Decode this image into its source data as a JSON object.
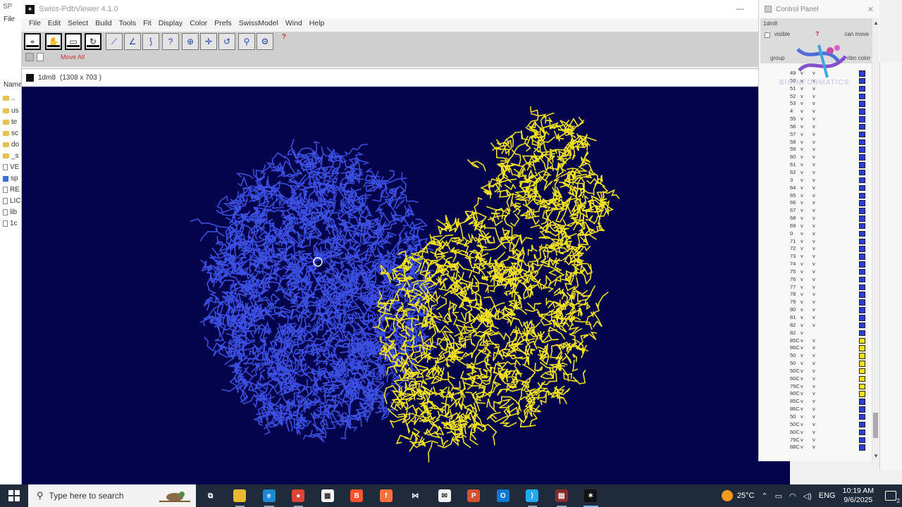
{
  "background_explorer": {
    "title": "SP",
    "file_menu": "File",
    "name_header": "Name",
    "rows": [
      {
        "icon": "folder",
        "label": ".."
      },
      {
        "icon": "folder",
        "label": "us"
      },
      {
        "icon": "folder",
        "label": "te"
      },
      {
        "icon": "folder",
        "label": "sc"
      },
      {
        "icon": "folder",
        "label": "do"
      },
      {
        "icon": "folder",
        "label": "_s"
      },
      {
        "icon": "file",
        "label": "VE"
      },
      {
        "icon": "selected",
        "label": "sp"
      },
      {
        "icon": "file",
        "label": "RE"
      },
      {
        "icon": "file",
        "label": "LIC"
      },
      {
        "icon": "file",
        "label": "lib"
      },
      {
        "icon": "file",
        "label": "1c"
      }
    ]
  },
  "app": {
    "title": "Swiss-PdbViewer 4.1.0",
    "menu": [
      "File",
      "Edit",
      "Select",
      "Build",
      "Tools",
      "Fit",
      "Display",
      "Color",
      "Prefs",
      "SwissModel",
      "Wind",
      "Help"
    ],
    "toolbar_help": "?",
    "move_all_label": "Move All",
    "tool_icons": [
      "select-tool-icon",
      "translate-tool-icon",
      "zoom-tool-icon",
      "rotate-tool-icon",
      "distance-tool-icon",
      "angle-tool-icon",
      "dihedral-tool-icon",
      "label-tool-icon",
      "center-tool-icon",
      "fit-tool-icon",
      "mutate-tool-icon",
      "torsion-tool-icon",
      "hbond-tool-icon"
    ],
    "tool_glyphs": [
      "⌖",
      "✋",
      "▭",
      "↻",
      "⟋",
      "∠",
      "⟆",
      "?",
      "⊕",
      "✛",
      "↺",
      "⚲",
      "⚙"
    ]
  },
  "viewer": {
    "title": "1dm8",
    "size_label": "(1308 x 703 )",
    "colors": {
      "background": "#04044d",
      "chain_a": "#3a4ee0",
      "chain_b": "#f0e020"
    }
  },
  "control_panel": {
    "title": "Control Panel",
    "protein_name": "1dm8",
    "visible_label": "visible",
    "help": "?",
    "can_move_label": "can move",
    "group_label": "group",
    "colors_label": "ribn color",
    "rows": [
      {
        "rn": "49",
        "v1": "v",
        "v2": "v",
        "color": "blue"
      },
      {
        "rn": "50",
        "v1": "v",
        "v2": "v",
        "color": "blue"
      },
      {
        "rn": "51",
        "v1": "v",
        "v2": "v",
        "color": "blue"
      },
      {
        "rn": "52",
        "v1": "v",
        "v2": "v",
        "color": "blue"
      },
      {
        "rn": "53",
        "v1": "v",
        "v2": "v",
        "color": "blue"
      },
      {
        "rn": "4",
        "v1": "v",
        "v2": "v",
        "color": "blue"
      },
      {
        "rn": "55",
        "v1": "v",
        "v2": "v",
        "color": "blue"
      },
      {
        "rn": "56",
        "v1": "v",
        "v2": "v",
        "color": "blue"
      },
      {
        "rn": "57",
        "v1": "v",
        "v2": "v",
        "color": "blue"
      },
      {
        "rn": "58",
        "v1": "v",
        "v2": "v",
        "color": "blue"
      },
      {
        "rn": "59",
        "v1": "v",
        "v2": "v",
        "color": "blue"
      },
      {
        "rn": "60",
        "v1": "v",
        "v2": "v",
        "color": "blue"
      },
      {
        "rn": "61",
        "v1": "v",
        "v2": "v",
        "color": "blue"
      },
      {
        "rn": "62",
        "v1": "v",
        "v2": "v",
        "color": "blue"
      },
      {
        "rn": "3",
        "v1": "v",
        "v2": "v",
        "color": "blue"
      },
      {
        "rn": "64",
        "v1": "v",
        "v2": "v",
        "color": "blue"
      },
      {
        "rn": "65",
        "v1": "v",
        "v2": "v",
        "color": "blue"
      },
      {
        "rn": "66",
        "v1": "v",
        "v2": "v",
        "color": "blue"
      },
      {
        "rn": "67",
        "v1": "v",
        "v2": "v",
        "color": "blue"
      },
      {
        "rn": "68",
        "v1": "v",
        "v2": "v",
        "color": "blue"
      },
      {
        "rn": "69",
        "v1": "v",
        "v2": "v",
        "color": "blue"
      },
      {
        "rn": "0",
        "v1": "v",
        "v2": "v",
        "color": "blue"
      },
      {
        "rn": "71",
        "v1": "v",
        "v2": "v",
        "color": "blue"
      },
      {
        "rn": "72",
        "v1": "v",
        "v2": "v",
        "color": "blue"
      },
      {
        "rn": "73",
        "v1": "v",
        "v2": "v",
        "color": "blue"
      },
      {
        "rn": "74",
        "v1": "v",
        "v2": "v",
        "color": "blue"
      },
      {
        "rn": "75",
        "v1": "v",
        "v2": "v",
        "color": "blue"
      },
      {
        "rn": "76",
        "v1": "v",
        "v2": "v",
        "color": "blue"
      },
      {
        "rn": "77",
        "v1": "v",
        "v2": "v",
        "color": "blue"
      },
      {
        "rn": "78",
        "v1": "v",
        "v2": "v",
        "color": "blue"
      },
      {
        "rn": "79",
        "v1": "v",
        "v2": "v",
        "color": "blue"
      },
      {
        "rn": "80",
        "v1": "v",
        "v2": "v",
        "color": "blue"
      },
      {
        "rn": "81",
        "v1": "v",
        "v2": "v",
        "color": "blue"
      },
      {
        "rn": "82",
        "v1": "v",
        "v2": "v",
        "color": "blue"
      },
      {
        "rn": "82",
        "v1": "v",
        "v2": "",
        "color": "blue"
      },
      {
        "rn": "85C",
        "v1": "v",
        "v2": "v",
        "color": "yellow"
      },
      {
        "rn": "86C",
        "v1": "v",
        "v2": "v",
        "color": "yellow"
      },
      {
        "rn": "50",
        "v1": "v",
        "v2": "v",
        "color": "yellow"
      },
      {
        "rn": "50",
        "v1": "v",
        "v2": "v",
        "color": "yellow"
      },
      {
        "rn": "50C",
        "v1": "v",
        "v2": "v",
        "color": "yellow"
      },
      {
        "rn": "60C",
        "v1": "v",
        "v2": "v",
        "color": "yellow"
      },
      {
        "rn": "79C",
        "v1": "v",
        "v2": "v",
        "color": "yellow"
      },
      {
        "rn": "80C",
        "v1": "v",
        "v2": "v",
        "color": "yellow"
      },
      {
        "rn": "85C",
        "v1": "v",
        "v2": "v",
        "color": "blue"
      },
      {
        "rn": "86C",
        "v1": "v",
        "v2": "v",
        "color": "blue"
      },
      {
        "rn": "50",
        "v1": "v",
        "v2": "v",
        "color": "blue"
      },
      {
        "rn": "50C",
        "v1": "v",
        "v2": "v",
        "color": "blue"
      },
      {
        "rn": "60C",
        "v1": "v",
        "v2": "v",
        "color": "blue"
      },
      {
        "rn": "79C",
        "v1": "v",
        "v2": "v",
        "color": "blue"
      },
      {
        "rn": "88C",
        "v1": "v",
        "v2": "v",
        "color": "blue"
      }
    ]
  },
  "watermark": "BIOINFORMATICS",
  "taskbar": {
    "search_placeholder": "Type here to search",
    "apps": [
      {
        "name": "task-view",
        "glyph": "⧉",
        "bg": "transparent"
      },
      {
        "name": "file-explorer",
        "glyph": "",
        "bg": "#e8b830"
      },
      {
        "name": "edge",
        "glyph": "e",
        "bg": "#1a8ad4"
      },
      {
        "name": "chrome",
        "glyph": "●",
        "bg": "#db4437"
      },
      {
        "name": "store",
        "glyph": "▦",
        "bg": "#f2f2f2"
      },
      {
        "name": "brave",
        "glyph": "B",
        "bg": "#fb542b"
      },
      {
        "name": "firefox",
        "glyph": "f",
        "bg": "#ff7139"
      },
      {
        "name": "visual-studio",
        "glyph": "⋈",
        "bg": "#1f2a3a"
      },
      {
        "name": "mail",
        "glyph": "✉",
        "bg": "#f2f2f2"
      },
      {
        "name": "powerpoint",
        "glyph": "P",
        "bg": "#d35230"
      },
      {
        "name": "outlook",
        "glyph": "O",
        "bg": "#0f78d4"
      },
      {
        "name": "vscode",
        "glyph": "⟩",
        "bg": "#23a9f2"
      },
      {
        "name": "winrar",
        "glyph": "▤",
        "bg": "#8a2b2b"
      },
      {
        "name": "swiss-pdbviewer",
        "glyph": "✶",
        "bg": "#111111"
      }
    ],
    "weather": "25°C",
    "lang": "ENG",
    "time": "10:19 AM",
    "date": "9/6/2025",
    "notification_count": "2"
  }
}
